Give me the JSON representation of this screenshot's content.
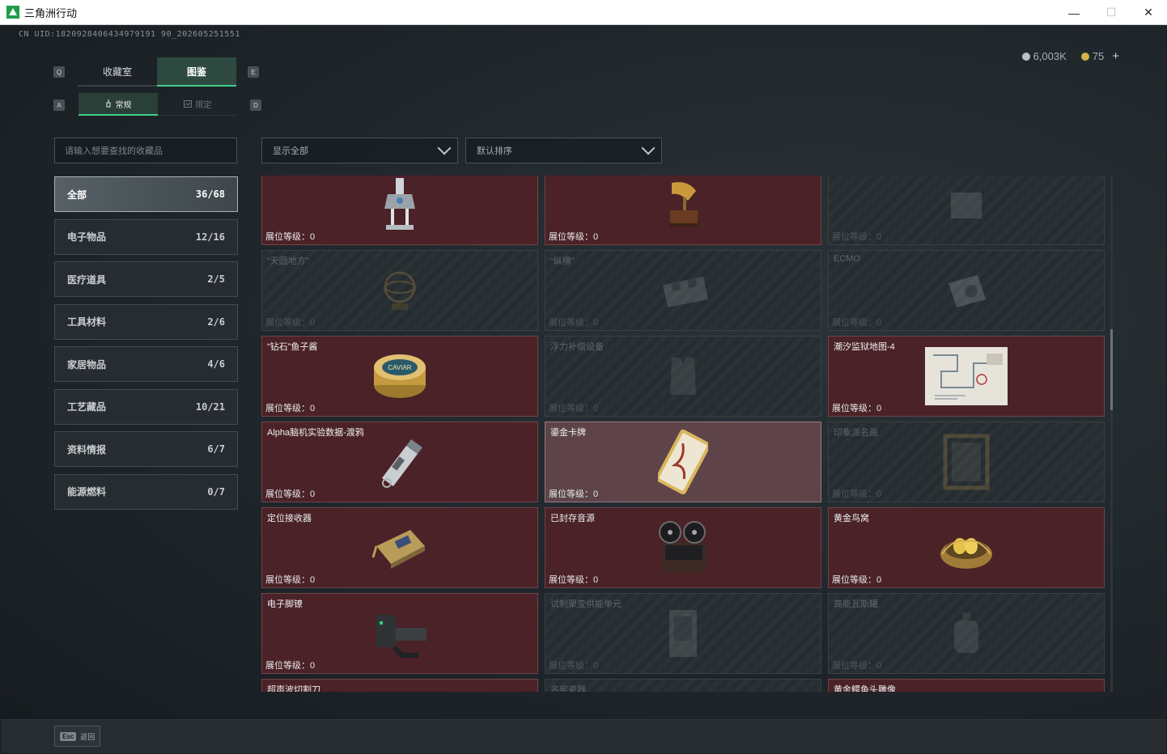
{
  "window": {
    "title": "三角洲行动",
    "minimize": "—",
    "maximize": "☐",
    "close": "✕"
  },
  "uid": "CN UID:1820928406434979191 90_202605251551",
  "currency": {
    "silver": "6,003K",
    "gold": "75",
    "plus": "+"
  },
  "keyhints": {
    "q": "Q",
    "e": "E",
    "a": "A",
    "d": "D"
  },
  "tabs": {
    "main": [
      {
        "label": "收藏室"
      },
      {
        "label": "图鉴"
      }
    ],
    "sub": [
      {
        "label": "常规"
      },
      {
        "label": "限定"
      }
    ]
  },
  "search": {
    "placeholder": "请输入想要查找的收藏品"
  },
  "filters": {
    "show": "显示全部",
    "sort": "默认排序"
  },
  "categories": [
    {
      "label": "全部",
      "count": "36/68"
    },
    {
      "label": "电子物品",
      "count": "12/16"
    },
    {
      "label": "医疗道具",
      "count": "2/5"
    },
    {
      "label": "工具材料",
      "count": "2/6"
    },
    {
      "label": "家居物品",
      "count": "4/6"
    },
    {
      "label": "工艺藏品",
      "count": "10/21"
    },
    {
      "label": "资料情报",
      "count": "6/7"
    },
    {
      "label": "能源燃料",
      "count": "0/7"
    }
  ],
  "level_label": "展位等级：0",
  "items": [
    {
      "name": "",
      "icon": "robot-arm-icon",
      "locked": false
    },
    {
      "name": "",
      "icon": "gramophone-icon",
      "locked": false
    },
    {
      "name": "",
      "icon": "box-icon",
      "locked": true
    },
    {
      "name": "“天圆地方”",
      "icon": "globe-icon",
      "locked": true
    },
    {
      "name": "“纵横”",
      "icon": "chessboard-icon",
      "locked": true
    },
    {
      "name": "ECMO",
      "icon": "machine-icon",
      "locked": true
    },
    {
      "name": "“钻石”鱼子酱",
      "icon": "caviar-tin-icon",
      "locked": false,
      "label": "CAVIAR"
    },
    {
      "name": "浮力补偿设备",
      "icon": "vest-icon",
      "locked": true
    },
    {
      "name": "潮汐监狱地图-4",
      "icon": "map-icon",
      "locked": false
    },
    {
      "name": "Alpha脑机实验数据-渡鸦",
      "icon": "data-canister-icon",
      "locked": false
    },
    {
      "name": "鎏金卡牌",
      "icon": "gilded-card-icon",
      "locked": false,
      "highlight": true
    },
    {
      "name": "印象派名画",
      "icon": "painting-frame-icon",
      "locked": true
    },
    {
      "name": "定位接收器",
      "icon": "gps-receiver-icon",
      "locked": false
    },
    {
      "name": "已封存音源",
      "icon": "reel-recorder-icon",
      "locked": false
    },
    {
      "name": "黄金鸟窝",
      "icon": "golden-nest-icon",
      "locked": false
    },
    {
      "name": "电子脚镣",
      "icon": "ankle-monitor-icon",
      "locked": false
    },
    {
      "name": "试制聚变供能单元",
      "icon": "fusion-cell-icon",
      "locked": true
    },
    {
      "name": "高能瓦斯罐",
      "icon": "gas-tank-icon",
      "locked": true
    },
    {
      "name": "超声波切割刀",
      "icon": "ultrasonic-cutter-icon",
      "locked": false
    },
    {
      "name": "名窑瓷器",
      "icon": "porcelain-icon",
      "locked": true
    },
    {
      "name": "黄金鳄鱼头雕像",
      "icon": "gold-croc-statue-icon",
      "locked": false
    }
  ],
  "bottom": {
    "esc_key": "Esc",
    "esc_label": "返回"
  }
}
